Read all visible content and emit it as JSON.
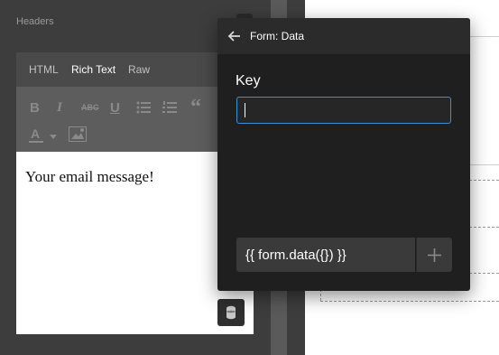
{
  "headers_label": "Headers",
  "editor": {
    "tabs": [
      "HTML",
      "Rich Text",
      "Raw"
    ],
    "active_tab": "Rich Text",
    "content": "Your email message!"
  },
  "toolbar_icons": [
    "bold-icon",
    "italic-icon",
    "strikethrough-icon",
    "underline-icon",
    "bullet-list-icon",
    "numbered-list-icon",
    "quote-icon",
    "text-color-icon",
    "image-icon"
  ],
  "popup": {
    "title": "Form: Data",
    "key_label": "Key",
    "key_value": "",
    "expression": "{{ form.data({}) }}"
  },
  "colors": {
    "focus_border": "#3b8fd9",
    "popup_bg": "#1f1f1f"
  }
}
